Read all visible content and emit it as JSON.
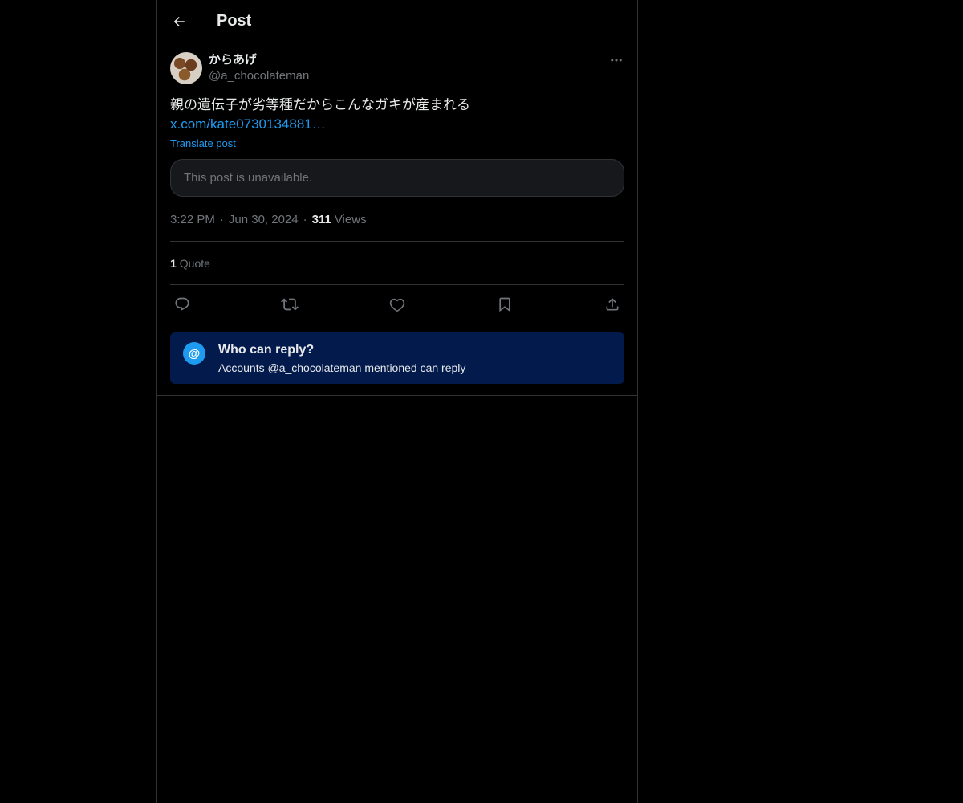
{
  "header": {
    "title": "Post",
    "back_icon": "arrow-left-icon"
  },
  "post": {
    "author": {
      "display_name": "からあげ",
      "handle": "@a_chocolateman"
    },
    "text": "親の遺伝子が劣等種だからこんなガキが産まれる",
    "link_text": "x.com/kate0730134881…",
    "translate_label": "Translate post",
    "quoted_unavailable": "This post is unavailable.",
    "time": "3:22 PM",
    "date": "Jun 30, 2024",
    "separator": "·",
    "views_count": "311",
    "views_label": "Views",
    "quotes_count": "1",
    "quotes_label": "Quote"
  },
  "actions": [
    {
      "icon": "reply-icon"
    },
    {
      "icon": "repost-icon"
    },
    {
      "icon": "like-icon"
    },
    {
      "icon": "bookmark-icon"
    },
    {
      "icon": "share-icon"
    }
  ],
  "who_can_reply": {
    "icon_glyph": "@",
    "title": "Who can reply?",
    "subtitle": "Accounts @a_chocolateman mentioned can reply"
  },
  "colors": {
    "background": "#000000",
    "accent": "#1d9bf0",
    "border": "#2f3336",
    "muted_text": "#71767b",
    "reply_banner": "#031a4d"
  }
}
